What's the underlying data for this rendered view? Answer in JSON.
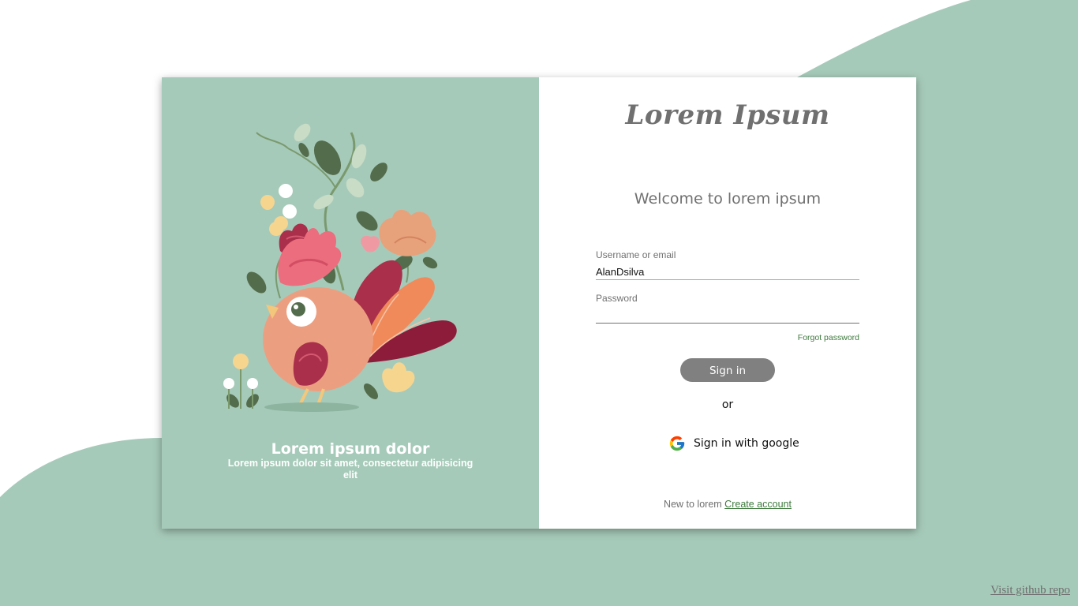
{
  "colors": {
    "accent": "#a6cab9",
    "button": "#808080",
    "link": "#3f7a3f",
    "text_muted": "#707070"
  },
  "left_panel": {
    "title": "Lorem ipsum dolor",
    "subtitle": "Lorem ipsum dolor sit amet, consectetur adipisicing elit",
    "illustration": "bird-with-flowers-illustration"
  },
  "right_panel": {
    "brand": "Lorem Ipsum",
    "welcome": "Welcome to lorem ipsum",
    "username": {
      "label": "Username or email",
      "value": "AlanDsilva"
    },
    "password": {
      "label": "Password",
      "value": ""
    },
    "forgot_password": "Forgot password",
    "sign_in": "Sign in",
    "or": "or",
    "google_sign_in": "Sign in with google",
    "google_icon": "google-icon",
    "footer_text": "New to lorem",
    "create_account": "Create account"
  },
  "repo_link": "Visit github repo"
}
